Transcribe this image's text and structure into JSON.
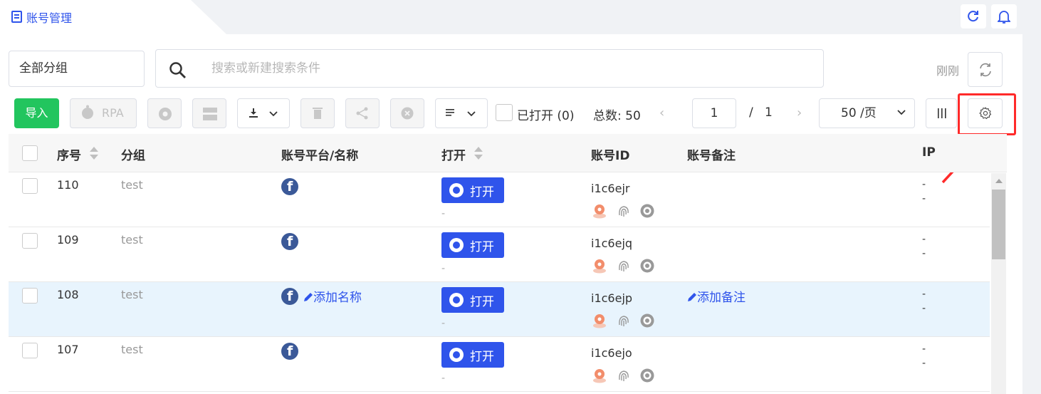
{
  "header": {
    "tab_title": "账号管理"
  },
  "filters": {
    "group_select": "全部分组",
    "search_placeholder": "搜索或新建搜索条件",
    "last_refresh": "刚刚"
  },
  "toolbar": {
    "import_label": "导入",
    "rpa_label": "RPA",
    "opened_label": "已打开 (0)",
    "total_label": "总数:",
    "total_value": "50",
    "prev": "‹",
    "next": "›",
    "page_current": "1",
    "page_slash": "/",
    "page_total": "1",
    "page_size": "50 /页",
    "columns_icon": "|||"
  },
  "table": {
    "columns": [
      "序号",
      "分组",
      "账号平台/名称",
      "打开",
      "账号ID",
      "账号备注",
      "IP"
    ],
    "open_label": "打开",
    "add_name_label": "添加名称",
    "add_note_label": "添加备注",
    "dash": "-",
    "rows": [
      {
        "no": "110",
        "group": "test",
        "account_id": "i1c6ejr",
        "ip1": "-",
        "ip2": "-"
      },
      {
        "no": "109",
        "group": "test",
        "account_id": "i1c6ejq",
        "ip1": "-",
        "ip2": "-"
      },
      {
        "no": "108",
        "group": "test",
        "account_id": "i1c6ejp",
        "ip1": "-",
        "ip2": "-"
      },
      {
        "no": "107",
        "group": "test",
        "account_id": "i1c6ejo",
        "ip1": "-",
        "ip2": "-"
      }
    ]
  },
  "colors": {
    "accent": "#2f54eb",
    "import_green": "#22c55e",
    "highlight_red": "#ff2a2a",
    "row_highlight": "#e8f4fd",
    "facebook_blue": "#3b5998"
  },
  "icons": [
    "document-icon",
    "refresh-icon",
    "bell-icon",
    "search-icon",
    "sync-icon",
    "robot-icon",
    "chrome-icon",
    "layout-icon",
    "download-icon",
    "trash-icon",
    "share-icon",
    "close-circle-icon",
    "list-icon",
    "columns-icon",
    "gear-icon",
    "facebook-icon",
    "pencil-icon",
    "location-icon",
    "fingerprint-icon",
    "target-icon"
  ]
}
